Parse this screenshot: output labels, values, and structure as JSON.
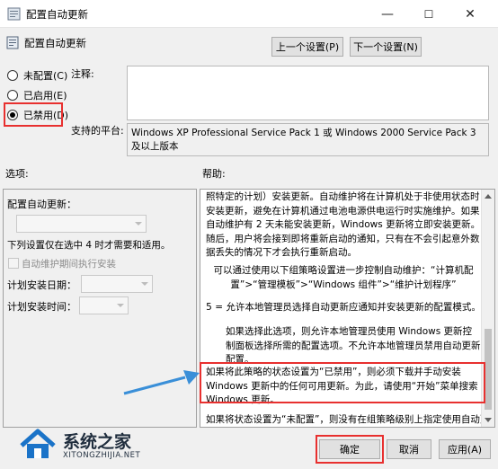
{
  "window": {
    "title": "配置自动更新",
    "minimize": "—",
    "maximize": "☐",
    "close": "✕"
  },
  "header": {
    "title": "配置自动更新",
    "prev_setting": "上一个设置(P)",
    "next_setting": "下一个设置(N)"
  },
  "radios": [
    {
      "label": "未配置(C)",
      "checked": false
    },
    {
      "label": "已启用(E)",
      "checked": false
    },
    {
      "label": "已禁用(D)",
      "checked": true
    }
  ],
  "comment_label": "注释:",
  "platform_label": "支持的平台:",
  "platform_text": "Windows XP Professional Service Pack 1 或 Windows 2000 Service Pack 3 及以上版本",
  "options_label": "选项:",
  "help_label": "帮助:",
  "options": {
    "configure_label": "配置自动更新：",
    "note": "下列设置仅在选中 4 时才需要和适用。",
    "maintenance_checkbox": "自动维护期间执行安装",
    "schedule_day_label": "计划安装日期：",
    "schedule_time_label": "计划安装时间："
  },
  "help": {
    "p1": "照特定的计划）安装更新。自动维护将在计算机处于非使用状态时安装更新，避免在计算机通过电池电源供电运行时实施维护。如果自动维护有 2 天未能安装更新，Windows 更新将立即安装更新。随后，用户将会接到即将重新启动的通知，只有在不会引起意外数据丢失的情况下才会执行重新启动。",
    "p2": "可以通过使用以下组策略设置进一步控制自动维护：“计算机配置”>“管理模板”>“Windows 组件”>“维护计划程序”",
    "p3": "5 = 允许本地管理员选择自动更新应通知并安装更新的配置模式。",
    "p4": "如果选择此选项，则允许本地管理员使用 Windows 更新控制面板选择所需的配置选项。不允许本地管理员禁用自动更新配置。",
    "p5": "如果将此策略的状态设置为“已禁用”，则必须下载并手动安装 Windows 更新中的任何可用更新。为此，请使用“开始”菜单搜索 Windows 更新。",
    "p6": "如果将状态设置为“未配置”，则没有在组策略级别上指定使用自动更新"
  },
  "footer": {
    "ok": "确定",
    "cancel": "取消",
    "apply": "应用(A)"
  },
  "watermark": {
    "name": "系统之家",
    "url": "XITONGZHIJIA.NET"
  },
  "colors": {
    "annotation_red": "#e8302f",
    "arrow_blue": "#3a8fd8"
  }
}
